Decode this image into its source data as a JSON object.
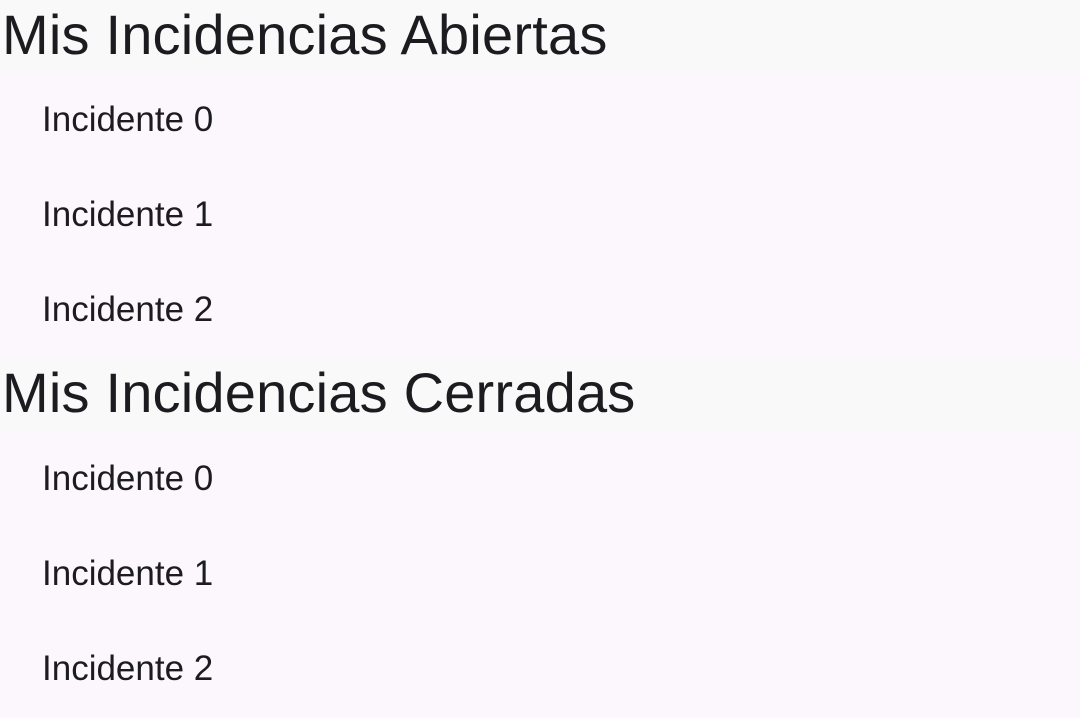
{
  "open_section": {
    "title": "Mis Incidencias Abiertas",
    "items": [
      {
        "label": "Incidente 0"
      },
      {
        "label": "Incidente 1"
      },
      {
        "label": "Incidente 2"
      }
    ]
  },
  "closed_section": {
    "title": "Mis Incidencias Cerradas",
    "items": [
      {
        "label": "Incidente 0"
      },
      {
        "label": "Incidente 1"
      },
      {
        "label": "Incidente 2"
      }
    ]
  },
  "colors": {
    "header_background": "#f9f9f9",
    "list_background": "#fcf7fc",
    "text": "#1c1b1f"
  }
}
